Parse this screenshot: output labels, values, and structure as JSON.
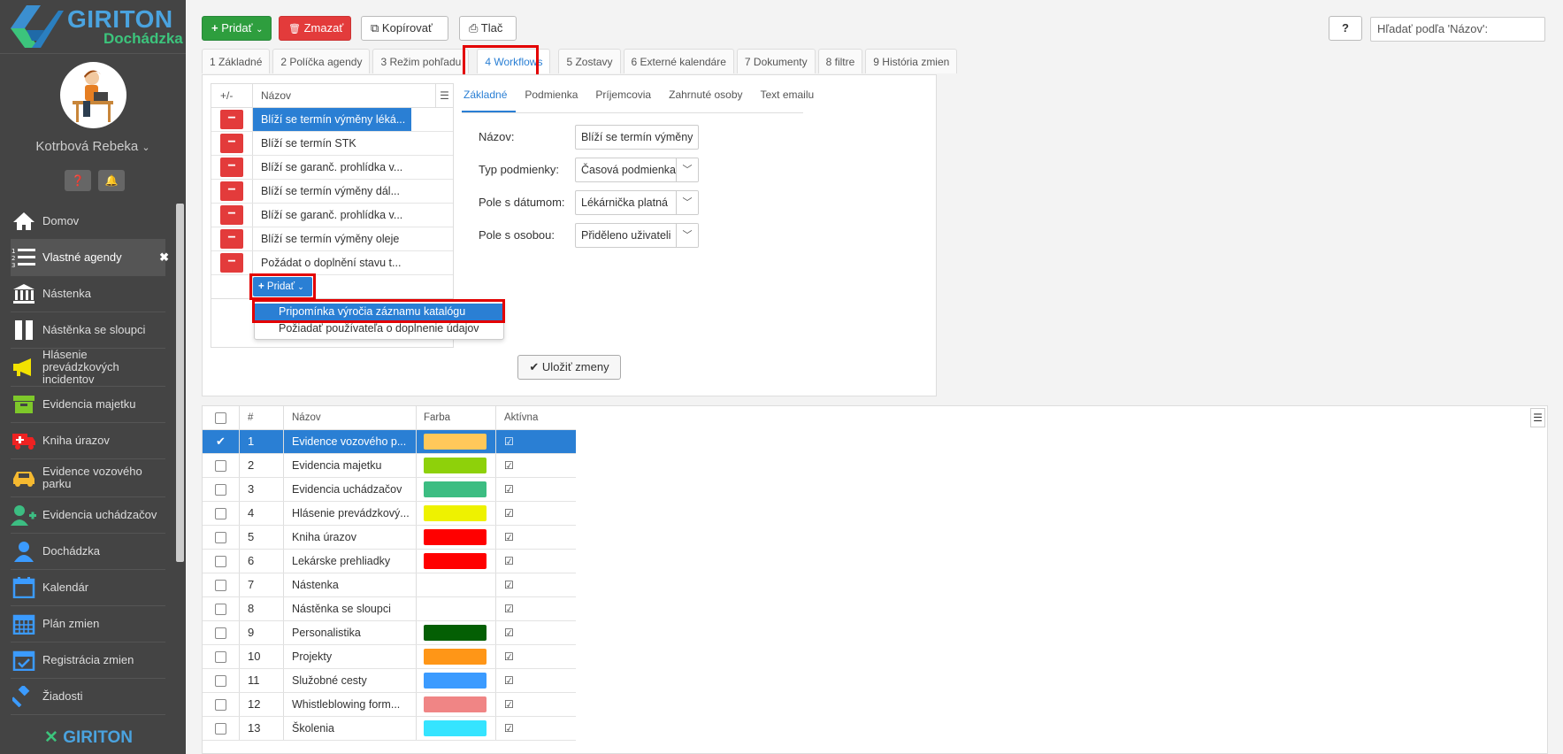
{
  "app": {
    "brand": "GIRITON",
    "sub": "Dochádzka",
    "footer_brand": "GIRITON"
  },
  "user": {
    "name": "Kotrbová Rebeka"
  },
  "sidebar": {
    "items": [
      {
        "label": "Domov",
        "icon": "home-icon",
        "active": false
      },
      {
        "label": "Vlastné agendy",
        "icon": "list-icon",
        "active": true
      },
      {
        "label": "Nástenka",
        "icon": "bank-icon",
        "active": false
      },
      {
        "label": "Nástěnka se sloupci",
        "icon": "columns-icon",
        "active": false
      },
      {
        "label": "Hlásenie prevádzkových incidentov",
        "icon": "megaphone-icon",
        "active": false
      },
      {
        "label": "Evidencia majetku",
        "icon": "archive-icon",
        "active": false
      },
      {
        "label": "Kniha úrazov",
        "icon": "ambulance-icon",
        "active": false
      },
      {
        "label": "Evidence vozového parku",
        "icon": "car-icon",
        "active": false
      },
      {
        "label": "Evidencia uchádzačov",
        "icon": "user-plus-icon",
        "active": false
      },
      {
        "label": "Dochádzka",
        "icon": "user-icon",
        "active": false
      },
      {
        "label": "Kalendár",
        "icon": "calendar-icon",
        "active": false
      },
      {
        "label": "Plán zmien",
        "icon": "calendar-grid-icon",
        "active": false
      },
      {
        "label": "Registrácia zmien",
        "icon": "calendar-check-icon",
        "active": false
      },
      {
        "label": "Žiadosti",
        "icon": "gavel-icon",
        "active": false
      }
    ]
  },
  "toolbar": {
    "add": "Pridať",
    "delete": "Zmazať",
    "copy": "Kopírovať",
    "print": "Tlač",
    "help": "?"
  },
  "search": {
    "placeholder": "Hľadať podľa 'Názov':"
  },
  "tabs": [
    "1 Základné",
    "2 Políčka agendy",
    "3 Režim pohľadu",
    "4 Workflows",
    "5 Zostavy",
    "6 Externé kalendáre",
    "7 Dokumenty",
    "8 filtre",
    "9 História zmien"
  ],
  "workflows": {
    "col_pm": "+/-",
    "col_name": "Názov",
    "rows": [
      "Blíží se termín výměny léká...",
      "Blíží se termín STK",
      "Blíží se garanč. prohlídka v...",
      "Blíží se termín výměny dál...",
      "Blíží se garanč. prohlídka v...",
      "Blíží se termín výměny oleje",
      "Požádat o doplnění stavu t..."
    ],
    "add_label": "Pridať",
    "dropdown": [
      "Pripomínka výročia záznamu katalógu",
      "Požiadať používateľa o doplnenie údajov"
    ]
  },
  "subtabs": [
    "Základné",
    "Podmienka",
    "Príjemcovia",
    "Zahrnuté osoby",
    "Text emailu"
  ],
  "form": {
    "name_label": "Názov:",
    "name_value": "Blíží se termín výměny",
    "type_label": "Typ podmienky:",
    "type_value": "Časová podmienka",
    "date_label": "Pole s dátumom:",
    "date_value": "Lékárnička platná",
    "person_label": "Pole s osobou:",
    "person_value": "Přiděleno uživateli",
    "save": "Uložiť zmeny"
  },
  "grid": {
    "headers": {
      "num": "#",
      "name": "Názov",
      "color": "Farba",
      "active": "Aktívna"
    },
    "rows": [
      {
        "num": "1",
        "name": "Evidence vozového p...",
        "color": "#ffc85a",
        "selected": true
      },
      {
        "num": "2",
        "name": "Evidencia majetku",
        "color": "#8ed10a",
        "selected": false
      },
      {
        "num": "3",
        "name": "Evidencia uchádzačov",
        "color": "#3cbd82",
        "selected": false
      },
      {
        "num": "4",
        "name": "Hlásenie prevádzkový...",
        "color": "#eef200",
        "selected": false
      },
      {
        "num": "5",
        "name": "Kniha úrazov",
        "color": "#ff0000",
        "selected": false
      },
      {
        "num": "6",
        "name": "Lekárske prehliadky",
        "color": "#ff0000",
        "selected": false
      },
      {
        "num": "7",
        "name": "Nástenka",
        "color": "",
        "selected": false
      },
      {
        "num": "8",
        "name": "Nástěnka se sloupci",
        "color": "#ffffff",
        "selected": false
      },
      {
        "num": "9",
        "name": "Personalistika",
        "color": "#045f04",
        "selected": false
      },
      {
        "num": "10",
        "name": "Projekty",
        "color": "#ff9617",
        "selected": false
      },
      {
        "num": "11",
        "name": "Služobné cesty",
        "color": "#3b9bff",
        "selected": false
      },
      {
        "num": "12",
        "name": "Whistleblowing form...",
        "color": "#f08585",
        "selected": false
      },
      {
        "num": "13",
        "name": "Školenia",
        "color": "#35e4ff",
        "selected": false
      }
    ]
  }
}
